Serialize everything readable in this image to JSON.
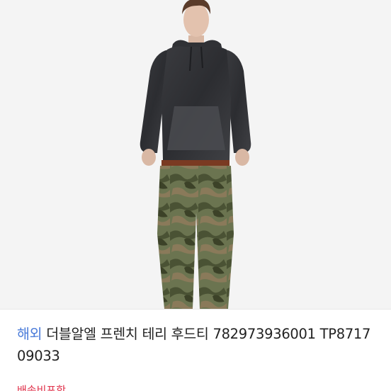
{
  "product": {
    "badge": "해외",
    "title": "더블알엘 프렌치 테리 후드티 782973936001 TP871709033",
    "shipping_label": "배송비포함"
  },
  "image": {
    "alt": "model-wearing-charcoal-hoodie-and-camo-pants"
  },
  "colors": {
    "background": "#ffffff",
    "image_background": "#f4f4f4",
    "badge": "#4a7bd9",
    "text": "#222222",
    "shipping": "#e0324b"
  }
}
